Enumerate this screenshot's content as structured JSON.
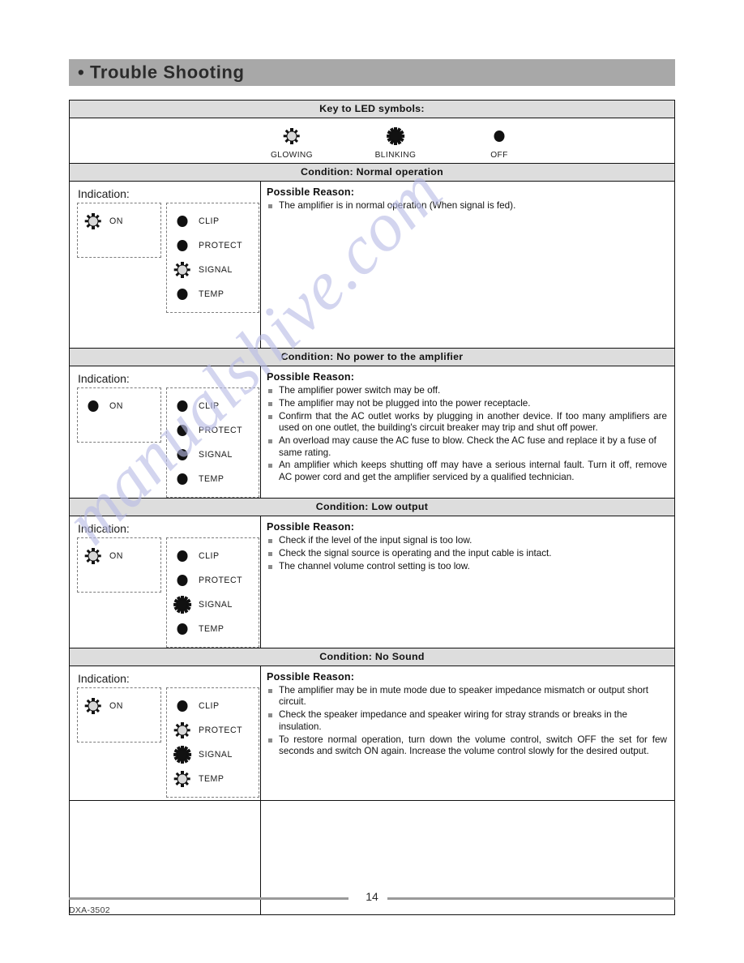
{
  "page": {
    "title": "Trouble Shooting",
    "title_bullet": "•",
    "page_number": "14",
    "model_code": "DXA-3502",
    "watermark": "manualshive.com",
    "accent_grey": "#a8a8a8",
    "band_grey": "#dddddd"
  },
  "key": {
    "heading": "Key to LED symbols:",
    "symbols": [
      {
        "state": "glowing",
        "label": "GLOWING",
        "icon": "led-glowing-icon"
      },
      {
        "state": "blinking",
        "label": "BLINKING",
        "icon": "led-blinking-icon"
      },
      {
        "state": "off",
        "label": "OFF",
        "icon": "led-off-icon"
      }
    ]
  },
  "labels": {
    "indication": "Indication:",
    "possible_reason": "Possible Reason:"
  },
  "led_names": {
    "power": "ON",
    "clip": "CLIP",
    "protect": "PROTECT",
    "signal": "SIGNAL",
    "temp": "TEMP"
  },
  "conditions": [
    {
      "band": "Condition: Normal operation",
      "leds": {
        "on": "glowing",
        "clip": "off",
        "protect": "off",
        "signal": "glowing",
        "temp": "off"
      },
      "reasons": [
        "The amplifier is in normal operation (When signal is fed)."
      ]
    },
    {
      "band": "Condition: No power to the amplifier",
      "leds": {
        "on": "off",
        "clip": "off",
        "protect": "off",
        "signal": "off",
        "temp": "off"
      },
      "reasons": [
        "The amplifier power switch may be off.",
        "The amplifier may not be plugged into the power receptacle.",
        "Confirm that the AC outlet works by plugging in another device. If too many amplifiers are used on one outlet, the building's circuit breaker may trip and shut off power.",
        "An overload may cause the AC fuse to blow. Check the AC fuse and replace it by a fuse of same rating.",
        "An amplifier which keeps shutting off may have a serious internal fault. Turn it off, remove AC power cord and get the amplifier serviced by a qualified technician."
      ]
    },
    {
      "band": "Condition: Low output",
      "leds": {
        "on": "glowing",
        "clip": "off",
        "protect": "off",
        "signal": "blinking",
        "temp": "off"
      },
      "reasons": [
        "Check if the level of the input signal is too low.",
        "Check the signal source is operating and the input cable is intact.",
        "The channel volume control setting is too low."
      ]
    },
    {
      "band": "Condition: No Sound",
      "leds": {
        "on": "glowing",
        "clip": "off",
        "protect": "glowing",
        "signal": "blinking",
        "temp": "glowing"
      },
      "reasons": [
        "The amplifier may be in mute mode due to speaker impedance mismatch or output short circuit.",
        "Check the speaker impedance and speaker wiring  for stray strands or breaks in the insulation.",
        "To restore normal operation, turn down the volume control, switch OFF the set for few seconds and switch ON again. Increase the volume control slowly for the desired output."
      ]
    }
  ]
}
